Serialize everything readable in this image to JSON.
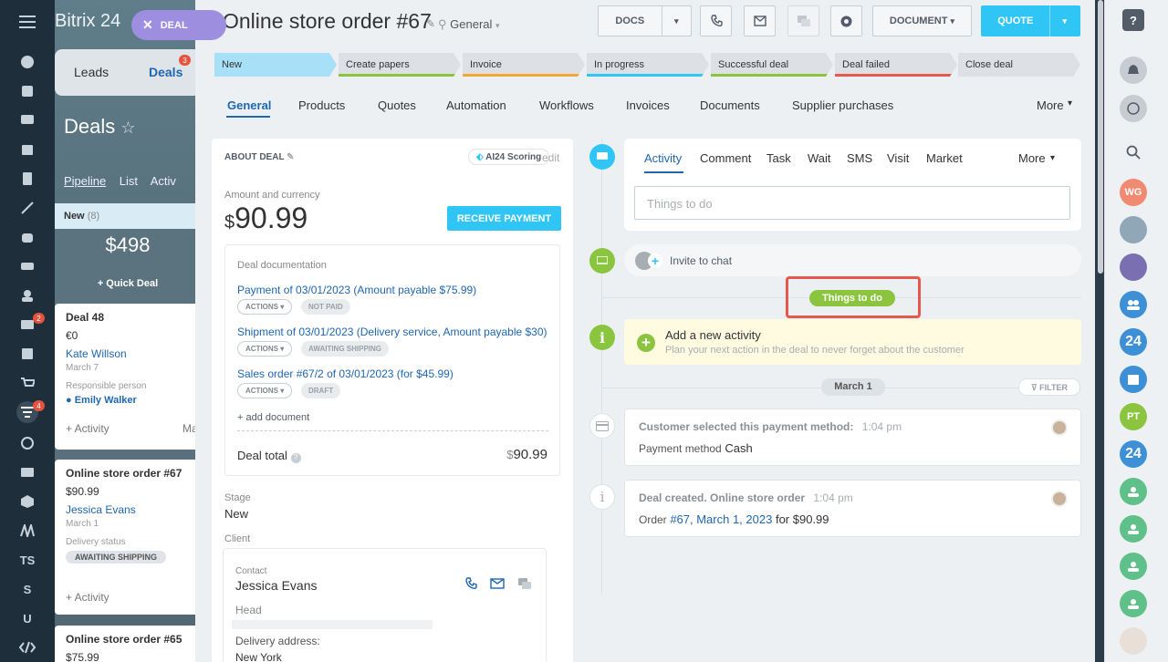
{
  "app": {
    "brand": "Bitrix 24",
    "deal_pill": "DEAL"
  },
  "left_nav": {
    "badges": [
      "2",
      "4"
    ],
    "letters": [
      "TS",
      "S",
      "U"
    ]
  },
  "background": {
    "tab_leads": "Leads",
    "tab_deals": "Deals",
    "deals_badge": "3",
    "deals_title": "Deals",
    "view_pipeline": "Pipeline",
    "view_list": "List",
    "view_activ": "Activ",
    "column_name": "New",
    "column_count": "(8)",
    "column_sum": "$498",
    "quick_deal": "+ Quick Deal",
    "card1": {
      "title": "Deal 48",
      "amount": "€0",
      "client": "Kate Willson",
      "date": "March 7",
      "resp_label": "Responsible person",
      "resp": "Emily Walker",
      "activity": "+ Activity",
      "ma": "Ma"
    },
    "card2": {
      "title": "Online store order #67",
      "amount": "$90.99",
      "client": "Jessica Evans",
      "date": "March 1",
      "status_label": "Delivery status",
      "status": "AWAITING SHIPPING",
      "activity": "+ Activity"
    },
    "card3": {
      "title": "Online store order #65",
      "amount": "$75.99"
    }
  },
  "header": {
    "title": "Online store order #67",
    "category": "General",
    "docs": "DOCS",
    "document": "DOCUMENT",
    "quote": "QUOTE"
  },
  "stages": [
    {
      "label": "New",
      "color": "#a8e1f7",
      "line": "#a8e1f7"
    },
    {
      "label": "Create papers",
      "color": "#dde1e6",
      "line": "#8bc53f"
    },
    {
      "label": "Invoice",
      "color": "#dde1e6",
      "line": "#f2a636"
    },
    {
      "label": "In progress",
      "color": "#dde1e6",
      "line": "#2fc6f6"
    },
    {
      "label": "Successful deal",
      "color": "#dde1e6",
      "line": "#8bc53f"
    },
    {
      "label": "Deal failed",
      "color": "#dde1e6",
      "line": "#e5584b"
    },
    {
      "label": "Close deal",
      "color": "#dde1e6",
      "line": "#dde1e6"
    }
  ],
  "tabs": [
    "General",
    "Products",
    "Quotes",
    "Automation",
    "Workflows",
    "Invoices",
    "Documents",
    "Supplier purchases",
    "More"
  ],
  "about": {
    "title": "ABOUT DEAL",
    "scoring": "AI24 Scoring",
    "edit": "edit",
    "amount_label": "Amount and currency",
    "currency": "$",
    "amount": "90.99",
    "receive": "RECEIVE PAYMENT",
    "doc_label": "Deal documentation",
    "docs": [
      {
        "text": "Payment of 03/01/2023 (Amount payable $75.99)",
        "actions": "ACTIONS",
        "status": "NOT PAID"
      },
      {
        "text": "Shipment of 03/01/2023 (Delivery service, Amount payable $30)",
        "actions": "ACTIONS",
        "status": "AWAITING SHIPPING"
      },
      {
        "text": "Sales order #67/2 of 03/01/2023 (for $45.99)",
        "actions": "ACTIONS",
        "status": "DRAFT"
      }
    ],
    "add_document": "+ add document",
    "total_label": "Deal total",
    "total_currency": "$",
    "total": "90.99",
    "stage_label": "Stage",
    "stage": "New",
    "client_label": "Client",
    "contact_label": "Contact",
    "contact_name": "Jessica Evans",
    "contact_role": "Head",
    "delivery_label": "Delivery address:",
    "delivery": "New York"
  },
  "activity": {
    "tabs": [
      "Activity",
      "Comment",
      "Task",
      "Wait",
      "SMS",
      "Visit",
      "Market",
      "More"
    ],
    "placeholder": "Things to do",
    "invite": "Invite to chat",
    "things_to_do": "Things to do",
    "add_title": "Add a new activity",
    "add_sub": "Plan your next action in the deal to never forget about the customer",
    "date": "March 1",
    "filter": "FILTER",
    "h1": {
      "title": "Customer selected this payment method:",
      "time": "1:04 pm",
      "label": "Payment method",
      "value": "Cash"
    },
    "h2": {
      "title": "Deal created. Online store order",
      "time": "1:04 pm",
      "prefix": "Order",
      "link": "#67, March 1, 2023",
      "suffix": "for $90.99"
    }
  },
  "right_bar": {
    "wg": "WG",
    "pt": "PT",
    "n24": "24"
  }
}
